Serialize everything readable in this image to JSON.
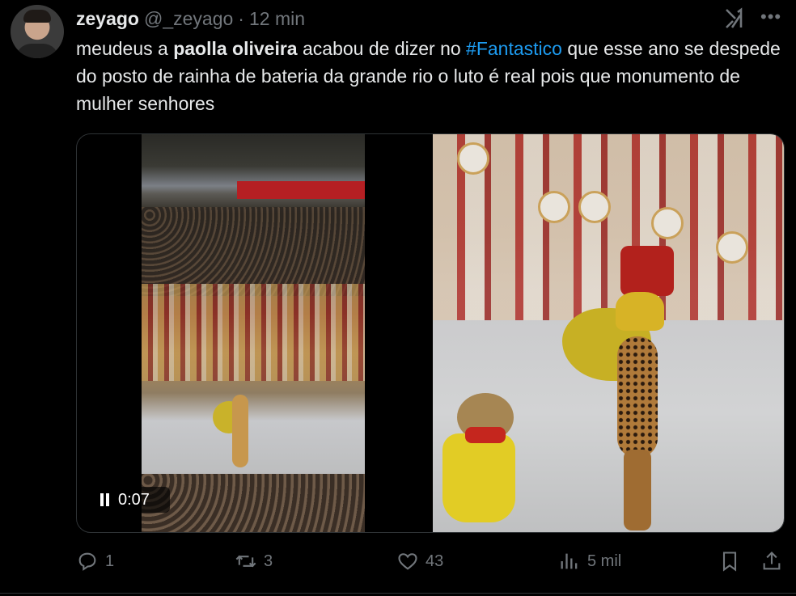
{
  "author": {
    "name": "zeyago",
    "handle": "@_zeyago",
    "separator": "·",
    "time": "12 min"
  },
  "tweet": {
    "part1": "meudeus a ",
    "bold": "paolla oliveira",
    "part2": " acabou de dizer no ",
    "hashtag": "#Fantastico",
    "part3": " que esse ano se despede do posto de rainha de bateria da grande rio o luto é real pois que monumento de mulher senhores"
  },
  "video": {
    "time": "0:07",
    "icon": "pause-icon"
  },
  "actions": {
    "replies": "1",
    "reposts": "3",
    "likes": "43",
    "views": "5 mil"
  },
  "colors": {
    "background": "#000000",
    "text": "#e7e9ea",
    "muted": "#71767b",
    "link": "#1d9bf0"
  }
}
